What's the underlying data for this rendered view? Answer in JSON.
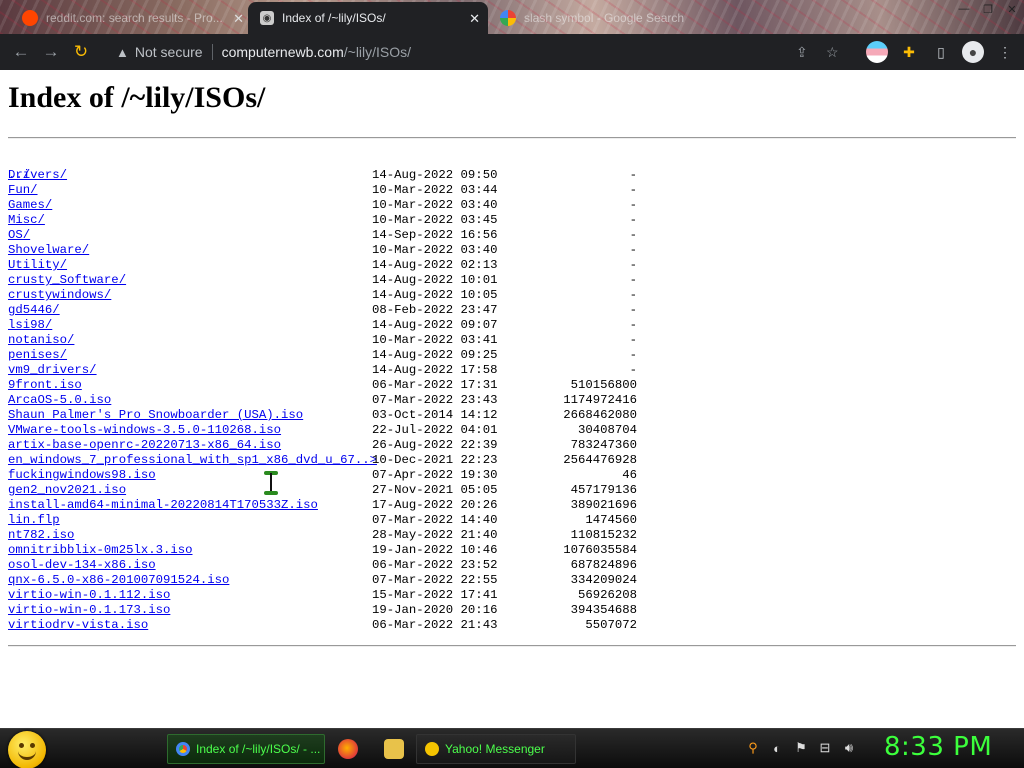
{
  "browser": {
    "tabs": [
      {
        "title": "reddit.com: search results - Pro...",
        "active": false
      },
      {
        "title": "Index of /~lily/ISOs/",
        "active": true
      },
      {
        "title": "slash symbol - Google Search",
        "active": false
      }
    ],
    "security_label": "Not secure",
    "url_host": "computernewb.com",
    "url_path": "/~lily/ISOs/"
  },
  "page": {
    "heading": "Index of /~lily/ISOs/",
    "parent_link": "../",
    "entries": [
      {
        "name": "Drivers/",
        "date": "14-Aug-2022 09:50",
        "size": "-"
      },
      {
        "name": "Fun/",
        "date": "10-Mar-2022 03:44",
        "size": "-"
      },
      {
        "name": "Games/",
        "date": "10-Mar-2022 03:40",
        "size": "-"
      },
      {
        "name": "Misc/",
        "date": "10-Mar-2022 03:45",
        "size": "-"
      },
      {
        "name": "OS/",
        "date": "14-Sep-2022 16:56",
        "size": "-"
      },
      {
        "name": "Shovelware/",
        "date": "10-Mar-2022 03:40",
        "size": "-"
      },
      {
        "name": "Utility/",
        "date": "14-Aug-2022 02:13",
        "size": "-"
      },
      {
        "name": "crusty_Software/",
        "date": "14-Aug-2022 10:01",
        "size": "-"
      },
      {
        "name": "crustywindows/",
        "date": "14-Aug-2022 10:05",
        "size": "-"
      },
      {
        "name": "gd5446/",
        "date": "08-Feb-2022 23:47",
        "size": "-"
      },
      {
        "name": "lsi98/",
        "date": "14-Aug-2022 09:07",
        "size": "-"
      },
      {
        "name": "notaniso/",
        "date": "10-Mar-2022 03:41",
        "size": "-"
      },
      {
        "name": "penises/",
        "date": "14-Aug-2022 09:25",
        "size": "-"
      },
      {
        "name": "vm9_drivers/",
        "date": "14-Aug-2022 17:58",
        "size": "-"
      },
      {
        "name": "9front.iso",
        "date": "06-Mar-2022 17:31",
        "size": "510156800"
      },
      {
        "name": "ArcaOS-5.0.iso",
        "date": "07-Mar-2022 23:43",
        "size": "1174972416"
      },
      {
        "name": "Shaun Palmer's Pro Snowboarder (USA).iso",
        "date": "03-Oct-2014 14:12",
        "size": "2668462080"
      },
      {
        "name": "VMware-tools-windows-3.5.0-110268.iso",
        "date": "22-Jul-2022 04:01",
        "size": "30408704"
      },
      {
        "name": "artix-base-openrc-20220713-x86_64.iso",
        "date": "26-Aug-2022 22:39",
        "size": "783247360"
      },
      {
        "name": "en_windows_7_professional_with_sp1_x86_dvd_u_67..>",
        "date": "10-Dec-2021 22:23",
        "size": "2564476928"
      },
      {
        "name": "fuckingwindows98.iso",
        "date": "07-Apr-2022 19:30",
        "size": "46"
      },
      {
        "name": "gen2_nov2021.iso",
        "date": "27-Nov-2021 05:05",
        "size": "457179136"
      },
      {
        "name": "install-amd64-minimal-20220814T170533Z.iso",
        "date": "17-Aug-2022 20:26",
        "size": "389021696"
      },
      {
        "name": "lin.flp",
        "date": "07-Mar-2022 14:40",
        "size": "1474560"
      },
      {
        "name": "nt782.iso",
        "date": "28-May-2022 21:40",
        "size": "110815232"
      },
      {
        "name": "omnitribblix-0m25lx.3.iso",
        "date": "19-Jan-2022 10:46",
        "size": "1076035584"
      },
      {
        "name": "osol-dev-134-x86.iso",
        "date": "06-Mar-2022 23:52",
        "size": "687824896"
      },
      {
        "name": "qnx-6.5.0-x86-201007091524.iso",
        "date": "07-Mar-2022 22:55",
        "size": "334209024"
      },
      {
        "name": "virtio-win-0.1.112.iso",
        "date": "15-Mar-2022 17:41",
        "size": "56926208"
      },
      {
        "name": "virtio-win-0.1.173.iso",
        "date": "19-Jan-2020 20:16",
        "size": "394354688"
      },
      {
        "name": "virtiodrv-vista.iso",
        "date": "06-Mar-2022 21:43",
        "size": "5507072"
      }
    ]
  },
  "taskbar": {
    "tasks": [
      {
        "label": "Index of /~lily/ISOs/ - ..."
      },
      {
        "label": "Yahoo! Messenger"
      }
    ],
    "clock": "8:33 PM"
  },
  "colors": {
    "link": "#0000ee",
    "clock": "#3cff3c",
    "toolbar": "#202124"
  }
}
